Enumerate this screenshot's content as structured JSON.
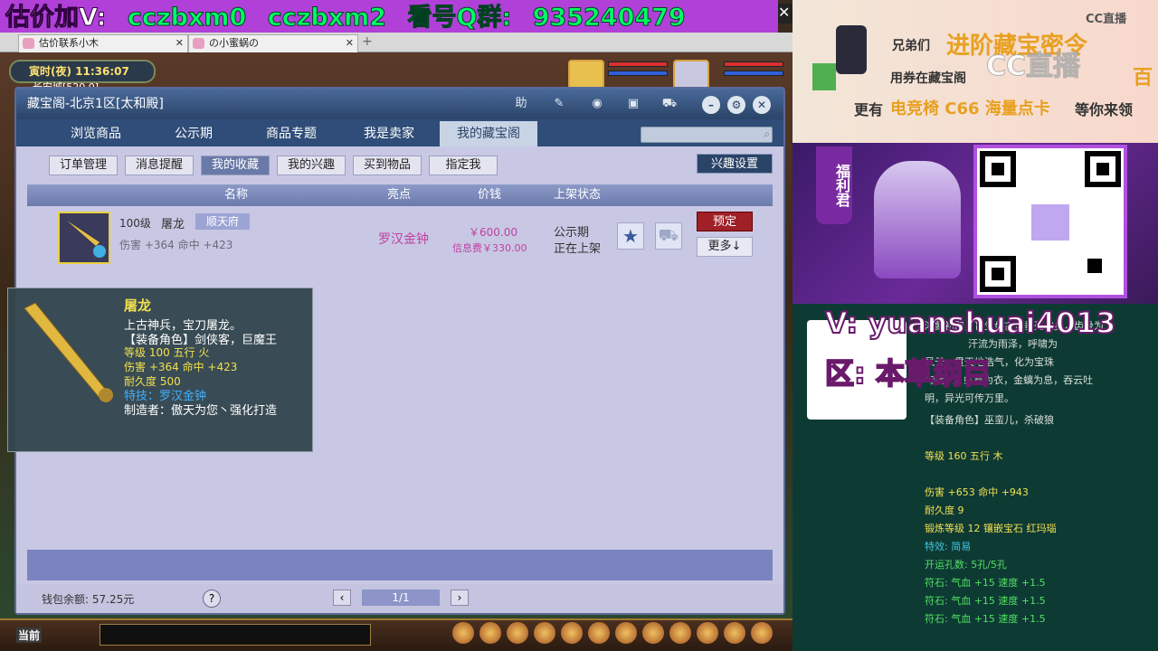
{
  "banner": {
    "p1": "估价加V:",
    "p2": "cczbxm0",
    "p3": "cczbxm2",
    "p4": "看号Q群:",
    "p5": "935240479"
  },
  "browser_tabs": [
    {
      "label": "估价联系小木"
    },
    {
      "label": "の小蜜蜗の"
    }
  ],
  "game": {
    "time": "寅时(夜)",
    "clock": "11:36:07",
    "location": "长安城[520,0]",
    "chat_label": "当前"
  },
  "dialog": {
    "title": "藏宝阁-北京1区[太和殿]",
    "help": "助",
    "nav_tabs": [
      "浏览商品",
      "公示期",
      "商品专题",
      "我是卖家",
      "我的藏宝阁"
    ],
    "sub_tabs": [
      "订单管理",
      "消息提醒",
      "我的收藏",
      "我的兴趣",
      "买到物品",
      "指定我"
    ],
    "fav_settings": "兴趣设置",
    "columns": {
      "name": "名称",
      "highlight": "亮点",
      "price": "价钱",
      "status": "上架状态"
    },
    "row": {
      "level": "100级",
      "name": "屠龙",
      "server": "顺天府",
      "attrs": "伤害 +364 命中 +423",
      "highlight": "罗汉金钟",
      "price": "￥600.00",
      "info_fee": "信息费￥330.00",
      "status1": "公示期",
      "status2": "正在上架",
      "reserve": "预定",
      "more": "更多↓"
    },
    "wallet": "钱包余额: 57.25元",
    "help_q": "?",
    "page": "1/1"
  },
  "tooltip": {
    "name": "屠龙",
    "desc1": "上古神兵，宝刀屠龙。",
    "desc2": "【装备角色】剑侠客，巨魔王",
    "stat1": "等级 100  五行 火",
    "stat2": "伤害 +364 命中 +423",
    "stat3": "耐久度 500",
    "skill": "特技：罗汉金钟",
    "maker": "制造者：傲天为您丶强化打造"
  },
  "ad": {
    "l1a": "兄弟们",
    "l1b": "进阶藏宝密令",
    "l2": "用券在藏宝阁",
    "l2b": "百",
    "l3a": "更有",
    "l3b": "电竞椅 C66 海量点卡",
    "l3c": "等你来领",
    "logo": "CC直播",
    "logo_big": "CC直播"
  },
  "qr_side": {
    "label": "福利君"
  },
  "overlay": {
    "v": "V: yuanshuai4013",
    "area": "区: 本草纲目"
  },
  "info_lines": [
    {
      "t": "鸿蒙初辟，盲生盘古，垂死化身，齿骨为",
      "c": ""
    },
    {
      "t": "汗流为雨泽，呼啸为",
      "c": ""
    },
    {
      "t": "风云，贯天地浩气，化为宝珠",
      "c": ""
    },
    {
      "t": "\"赤明\"，虹霓为衣，金螭为息，吞云吐",
      "c": ""
    },
    {
      "t": "明，异光可传万里。",
      "c": ""
    },
    {
      "t": "【装备角色】巫蛮儿，杀破狼",
      "c": ""
    },
    {
      "t": "等级 160 五行 木",
      "c": "y"
    },
    {
      "t": "伤害 +653 命中 +943",
      "c": "y"
    },
    {
      "t": "耐久度 9",
      "c": "y"
    },
    {
      "t": "锻炼等级 12 镶嵌宝石 红玛瑙",
      "c": "y"
    },
    {
      "t": "特效: 简易",
      "c": "c"
    },
    {
      "t": "开运孔数: 5孔/5孔",
      "c": "g"
    },
    {
      "t": "符石: 气血 +15 速度 +1.5",
      "c": "g"
    },
    {
      "t": "符石: 气血 +15 速度 +1.5",
      "c": "g"
    },
    {
      "t": "符石: 气血 +15 速度 +1.5",
      "c": "g"
    }
  ]
}
